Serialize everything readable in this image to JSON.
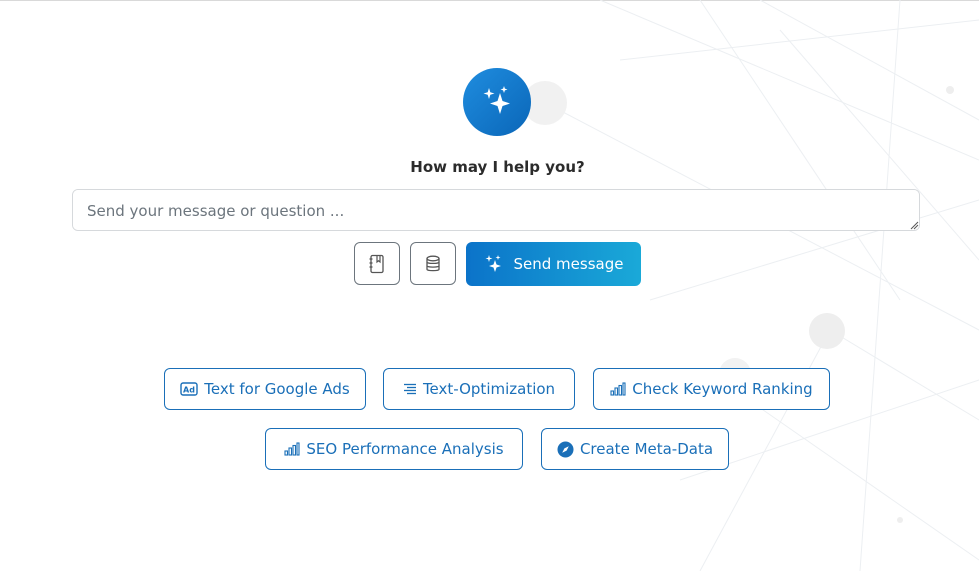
{
  "prompt": {
    "title": "How may I help you?",
    "placeholder": "Send your message or question ..."
  },
  "actions": {
    "notebook_icon": "notebook-icon",
    "database_icon": "database-icon",
    "send_label": "Send message"
  },
  "suggestions": [
    {
      "label": "Text for Google Ads",
      "icon": "ad-icon"
    },
    {
      "label": "Text-Optimization",
      "icon": "list-icon"
    },
    {
      "label": "Check Keyword Ranking",
      "icon": "bar-chart-icon"
    },
    {
      "label": "SEO Performance Analysis",
      "icon": "bar-chart-icon"
    },
    {
      "label": "Create Meta-Data",
      "icon": "compass-icon"
    }
  ],
  "colors": {
    "accent": "#1a6fb8",
    "send_gradient_start": "#0b73c9",
    "send_gradient_end": "#1aa9d8",
    "avatar": "#1680d2"
  }
}
